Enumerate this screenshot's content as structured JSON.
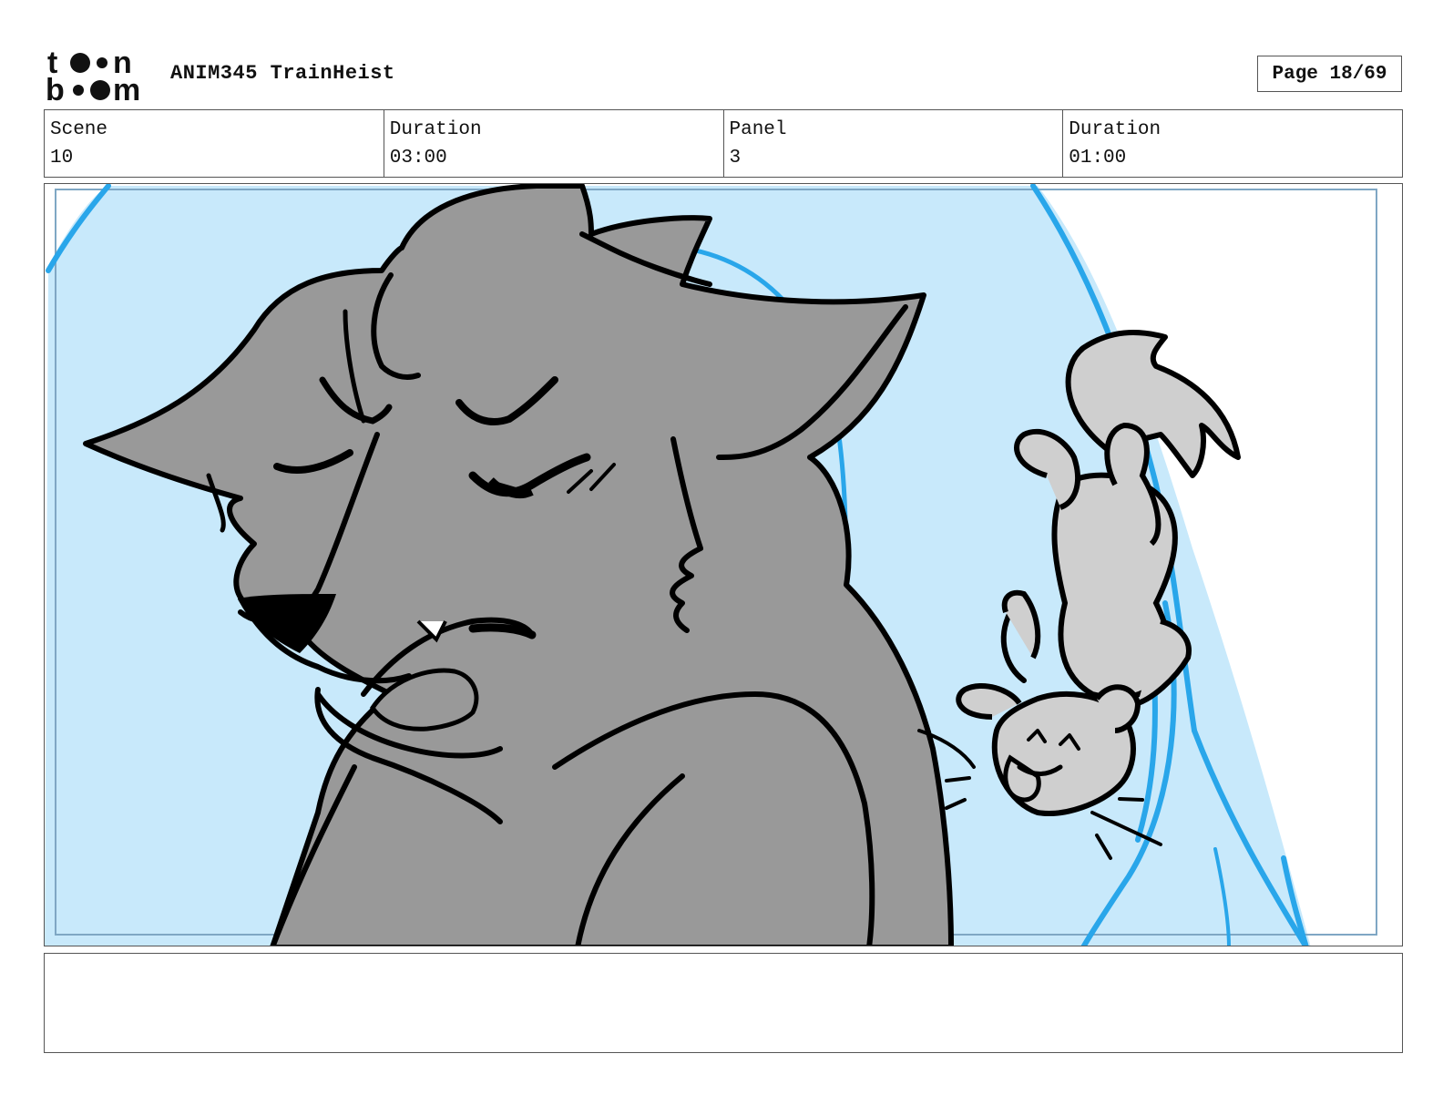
{
  "header": {
    "logo_text": "toon boom",
    "project_title": "ANIM345 TrainHeist",
    "page_label": "Page 18/69"
  },
  "info": [
    {
      "label": "Scene",
      "value": "10"
    },
    {
      "label": "Duration",
      "value": "03:00"
    },
    {
      "label": "Panel",
      "value": "3"
    },
    {
      "label": "Duration",
      "value": "01:00"
    }
  ],
  "panel": {
    "sky_color": "#c8e9fb",
    "accent_line_color": "#29a6ea",
    "wolf_fill": "#999999",
    "small_creature_fill": "#cfcfcf",
    "ink_color": "#000000"
  },
  "notes": {
    "text": ""
  }
}
